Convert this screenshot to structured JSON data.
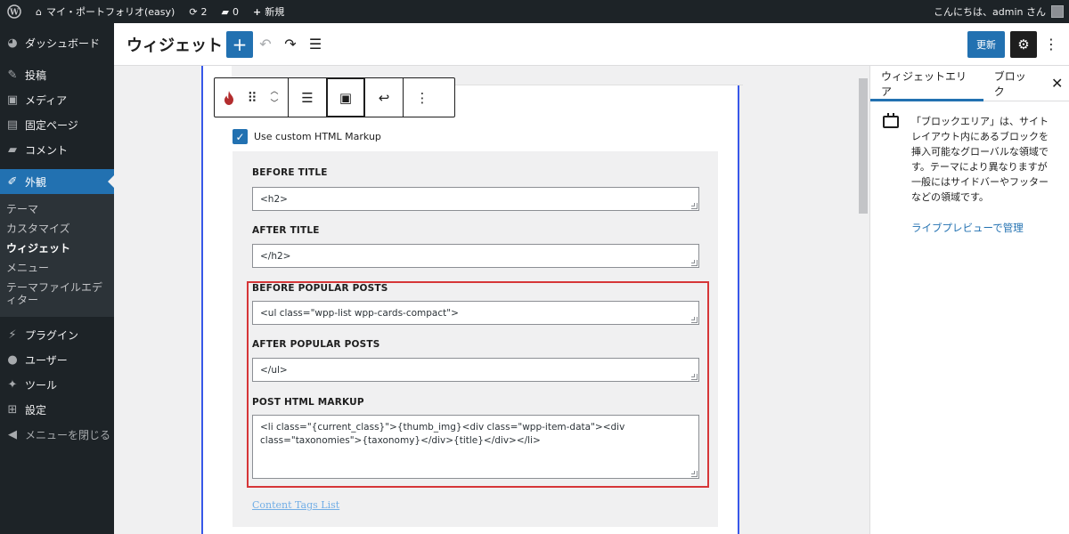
{
  "adminbar": {
    "site_name": "マイ・ポートフォリオ(easy)",
    "updates_count": "2",
    "comments_count": "0",
    "new_label": "新規",
    "greeting": "こんにちは、admin さん"
  },
  "menu": {
    "dashboard": "ダッシュボード",
    "posts": "投稿",
    "media": "メディア",
    "pages": "固定ページ",
    "comments": "コメント",
    "appearance": "外観",
    "sub_themes": "テーマ",
    "sub_customize": "カスタマイズ",
    "sub_widgets": "ウィジェット",
    "sub_menus": "メニュー",
    "sub_theme_editor": "テーマファイルエディター",
    "plugins": "プラグイン",
    "users": "ユーザー",
    "tools": "ツール",
    "settings": "設定",
    "collapse": "メニューを閉じる"
  },
  "header": {
    "title": "ウィジェット",
    "update_label": "更新"
  },
  "form": {
    "checkbox_label": "Use custom HTML Markup",
    "before_title_label": "BEFORE TITLE",
    "before_title_value": "<h2>",
    "after_title_label": "AFTER TITLE",
    "after_title_value": "</h2>",
    "before_posts_label": "BEFORE POPULAR POSTS",
    "before_posts_value": "<ul class=\"wpp-list wpp-cards-compact\">",
    "after_posts_label": "AFTER POPULAR POSTS",
    "after_posts_value": "</ul>",
    "post_markup_label": "POST HTML MARKUP",
    "post_markup_value": "<li class=\"{current_class}\">{thumb_img}<div class=\"wpp-item-data\"><div class=\"taxonomies\">{taxonomy}</div>{title}</div></li>",
    "tags_link": "Content Tags List"
  },
  "sidebar": {
    "tab_widget_area": "ウィジェットエリア",
    "tab_block": "ブロック",
    "description": "「ブロックエリア」は、サイトレイアウト内にあるブロックを挿入可能なグローバルな領域です。テーマにより異なりますが一般にはサイドバーやフッターなどの領域です。",
    "link": "ライブプレビューで管理"
  },
  "colors": {
    "accent": "#2271b1",
    "admin_dark": "#1d2327",
    "highlight_red": "#d63638",
    "plugin_flame": "#b32d2e"
  }
}
